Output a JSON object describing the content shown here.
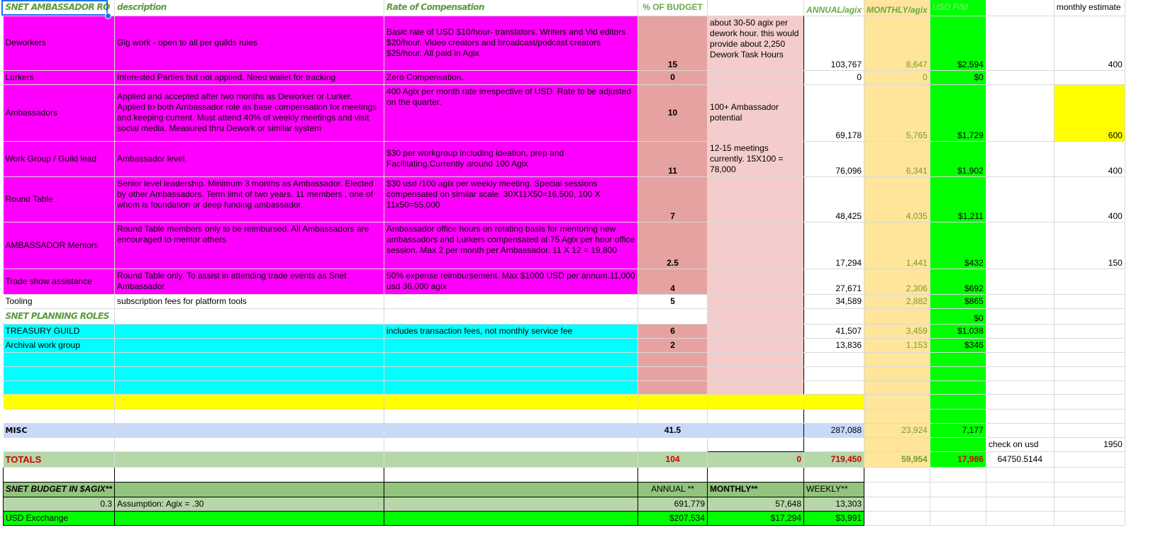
{
  "header": {
    "role": "SNET AMBASSADOR RO",
    "description": "description",
    "rate": "Rate of Compensation",
    "pct_budget": "% OF BUDGET",
    "annual": "ANNUAL/agix",
    "monthly": "MONTHLY/agix",
    "usd_pm": "USD P/M",
    "monthly_estimate": "monthly estimate"
  },
  "rows": [
    {
      "role": "Deworkers",
      "desc": "Gig work - open to all per guilds rules",
      "rate": "Basic rate of USD $10/hour- translators. Writers and Vid editors $20/hour. Video creators and broadcast/podcast creators $25/hour.  All paid in Agix",
      "pct": "15",
      "note": "about 30-50 agix per dework hour. this would provide about 2,250 Dework Task Hours",
      "annual": "103,767",
      "monthly": "8,647",
      "usd": "$2,594",
      "est": "400"
    },
    {
      "role": "Lurkers",
      "desc": "Interested Parties but not applied. Need wallet for tracking",
      "rate": "Zero Compensation.",
      "pct": "0",
      "note": "",
      "annual": "0",
      "monthly": "0",
      "usd": "$0",
      "est": ""
    },
    {
      "role": "Ambassadors",
      "desc": "Applied and accepted after two months as Deworker or Lurker. Applied to both Ambassador role as base compensation for meetings and keeping current. Must attend 40% of weekly meetings and visit social media. Measured thru Dework or similar system",
      "rate": "400 Agix per month rate irrespective of USD. Rate to be adjusted on the quarter.",
      "pct": "10",
      "note": "100+ Ambassador potential",
      "annual": "69,178",
      "monthly": "5,765",
      "usd": "$1,729",
      "est": "600"
    },
    {
      "role": "Work Group / Guild lead",
      "desc": "Ambassador level.",
      "rate": "$30 per workgroup including ideation, prep and Facilitating.Currently around 100 Agix",
      "pct": "11",
      "note": "12-15 meetings currently. 15X100 = 78,000",
      "annual": "76,096",
      "monthly": "6,341",
      "usd": "$1,902",
      "est": "400"
    },
    {
      "role": "Round Table",
      "desc": "Senior level leadership. Minimum 3 months as Ambassador. Elected by other Ambassadors. Term limit of two years. 11 members , one of whom is foundation or deep funding ambassador.",
      "rate": "$30 usd /100 agix per weekly meeting. Special sessions compensated on similar scale. 30X11X50=16,500. 100 X 11x50=55,000",
      "pct": "7",
      "note": "",
      "annual": "48,425",
      "monthly": "4,035",
      "usd": "$1,211",
      "est": "400"
    },
    {
      "role": "AMBASSADOR Mentors",
      "desc": "Round Table members only to be reimbursed.  All Ambassadors are encouraged to mentor others",
      "rate": "Ambassador office hours on rotating basis for mentoring new ambassadors and Lurkers compensated at 75 Agix per hour office session. Max 2 per month per Ambassador. 11 X 12 = 19,800",
      "pct": "2.5",
      "note": "",
      "annual": "17,294",
      "monthly": "1,441",
      "usd": "$432",
      "est": "150"
    },
    {
      "role": "Trade show assistance",
      "desc": "Round Table only. To assist in attending trade events as Snet Ambassador",
      "rate": "50% expense reimbursement.  Max $1000 USD per annum.11,000 usd 36,000 agix",
      "pct": "4",
      "note": "",
      "annual": "27,671",
      "monthly": "2,306",
      "usd": "$692",
      "est": ""
    },
    {
      "role": "Tooling",
      "desc": "subscription fees for platform tools",
      "rate": "",
      "pct": "5",
      "note": "",
      "annual": "34,589",
      "monthly": "2,882",
      "usd": "$865",
      "est": ""
    }
  ],
  "planning_header": "SNET PLANNING ROLES",
  "planning_usd": "$0",
  "planning": [
    {
      "role": "TREASURY GUILD",
      "rate": "includes transaction fees, not monthly service fee",
      "pct": "6",
      "annual": "41,507",
      "monthly": "3,459",
      "usd": "$1,038"
    },
    {
      "role": "Archival work group",
      "rate": "",
      "pct": "2",
      "annual": "13,836",
      "monthly": "1,153",
      "usd": "$346"
    }
  ],
  "misc": {
    "label": "MISC",
    "pct": "41.5",
    "annual": "287,088",
    "monthly": "23,924",
    "usd": "7,177"
  },
  "check": {
    "label": "check on usd",
    "value": "1950",
    "calc": "64750.5144"
  },
  "totals": {
    "label": "TOTALS",
    "pct": "104",
    "note": "0",
    "annual": "719,450",
    "monthly": "59,954",
    "usd": "17,986"
  },
  "budget": {
    "label": "SNET BUDGET IN $AGIX**",
    "annual_label": "ANNUAL **",
    "monthly_label": "MONTHLY**",
    "weekly_label": "WEEKLY**",
    "rate": "0.3",
    "assumption": "Assumption: Agix = .30",
    "annual": "691,779",
    "monthly": "57,648",
    "weekly": "13,303",
    "usd_label": "USD Excchange",
    "usd_annual": "$207,534",
    "usd_monthly": "$17,294",
    "usd_weekly": "$3,991"
  },
  "colors": {
    "magenta": "#ff00ff",
    "cyan": "#00ffff",
    "yellow": "#ffff00",
    "green": "#00ff00",
    "pink": "#e6a1a1",
    "light_pink": "#f4cccc",
    "tan": "#ffe599",
    "sage": "#b6d7a8",
    "light_blue": "#c9daf8"
  }
}
